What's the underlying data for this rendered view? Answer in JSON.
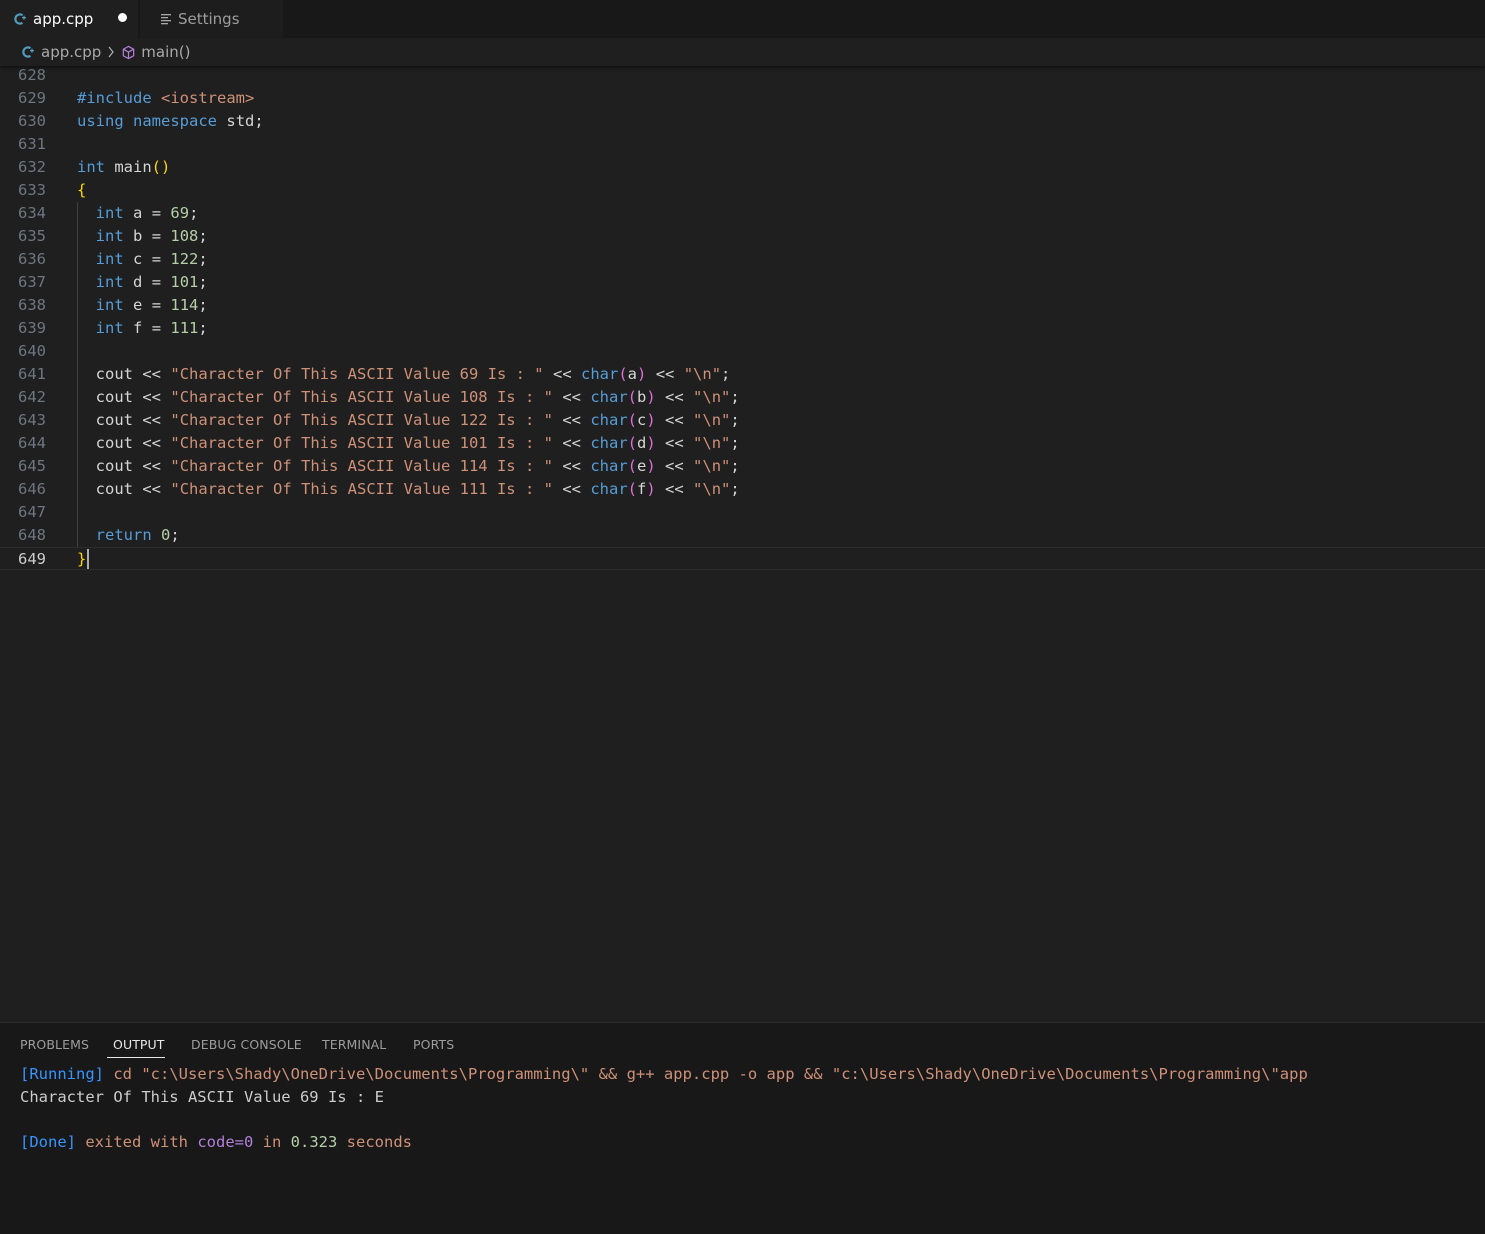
{
  "tabs": [
    {
      "label": "app.cpp",
      "active": true,
      "dirty": true,
      "icon": "cpp-file-icon"
    },
    {
      "label": "Settings",
      "active": false,
      "icon": "settings-list-icon"
    }
  ],
  "breadcrumb": {
    "file": "app.cpp",
    "symbol": "main()"
  },
  "editor": {
    "current_line": 649,
    "lines": [
      {
        "n": "628",
        "code": ""
      },
      {
        "n": "629",
        "code": "#include <iostream>"
      },
      {
        "n": "630",
        "code": "using namespace std;"
      },
      {
        "n": "631",
        "code": ""
      },
      {
        "n": "632",
        "code": "int main()"
      },
      {
        "n": "633",
        "code": "{"
      },
      {
        "n": "634",
        "code": "  int a = 69;"
      },
      {
        "n": "635",
        "code": "  int b = 108;"
      },
      {
        "n": "636",
        "code": "  int c = 122;"
      },
      {
        "n": "637",
        "code": "  int d = 101;"
      },
      {
        "n": "638",
        "code": "  int e = 114;"
      },
      {
        "n": "639",
        "code": "  int f = 111;"
      },
      {
        "n": "640",
        "code": ""
      },
      {
        "n": "641",
        "code": "  cout << \"Character Of This ASCII Value 69 Is : \" << char(a) << \"\\n\";"
      },
      {
        "n": "642",
        "code": "  cout << \"Character Of This ASCII Value 108 Is : \" << char(b) << \"\\n\";"
      },
      {
        "n": "643",
        "code": "  cout << \"Character Of This ASCII Value 122 Is : \" << char(c) << \"\\n\";"
      },
      {
        "n": "644",
        "code": "  cout << \"Character Of This ASCII Value 101 Is : \" << char(d) << \"\\n\";"
      },
      {
        "n": "645",
        "code": "  cout << \"Character Of This ASCII Value 114 Is : \" << char(e) << \"\\n\";"
      },
      {
        "n": "646",
        "code": "  cout << \"Character Of This ASCII Value 111 Is : \" << char(f) << \"\\n\";"
      },
      {
        "n": "647",
        "code": ""
      },
      {
        "n": "648",
        "code": "  return 0;"
      },
      {
        "n": "649",
        "code": "}"
      }
    ]
  },
  "panel": {
    "tabs": [
      "PROBLEMS",
      "OUTPUT",
      "DEBUG CONSOLE",
      "TERMINAL",
      "PORTS"
    ],
    "active_tab": "OUTPUT",
    "output": {
      "running_tag": "[Running]",
      "running_cmd": " cd \"c:\\Users\\Shady\\OneDrive\\Documents\\Programming\\\" && g++ app.cpp -o app && \"c:\\Users\\Shady\\OneDrive\\Documents\\Programming\\\"app",
      "result_line": "Character Of This ASCII Value 69 Is : E",
      "done_tag": "[Done]",
      "done_text1": " exited with ",
      "done_code": "code=0",
      "done_text2": " in ",
      "done_time": "0.323",
      "done_text3": " seconds"
    }
  },
  "colors": {
    "background": "#1f1f1f",
    "tabbar": "#181818",
    "keyword": "#569cd6",
    "string": "#ce9178",
    "number": "#b5cea8",
    "bracket": "#ffd700",
    "output_blue": "#3794ff"
  }
}
